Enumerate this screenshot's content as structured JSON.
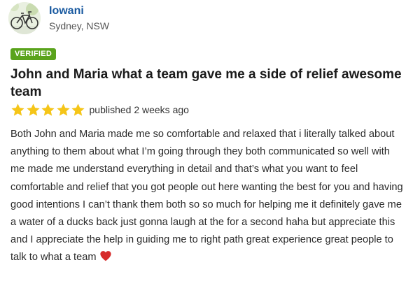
{
  "reviewer": {
    "name": "Iowani",
    "location": "Sydney, NSW",
    "avatar_icon": "bicycle-avatar"
  },
  "badge": {
    "label": "VERIFIED",
    "color": "#5aa31c"
  },
  "review": {
    "title": "John and Maria what a team gave me a side of relief awesome team",
    "rating": 5,
    "rating_max": 5,
    "star_color": "#f5c518",
    "published": "published 2 weeks ago",
    "body": "Both John and Maria made me so comfortable and relaxed that i literally talked about anything to them about what I’m going through they both communicated so well with me made me understand everything in detail and that’s what you want to feel comfortable and relief that you got people out here wanting the best for you and having good intentions I can’t thank them both so so much for helping me it definitely gave me a water of a ducks back just gonna laugh at the for a second haha but appreciate this and I appreciate the help in guiding me to right path great experience great people to talk to what a team",
    "end_icon": "heart-icon",
    "heart_color": "#d62b2b"
  },
  "colors": {
    "name_link": "#1a5aa0",
    "text": "#2a2a2a"
  }
}
